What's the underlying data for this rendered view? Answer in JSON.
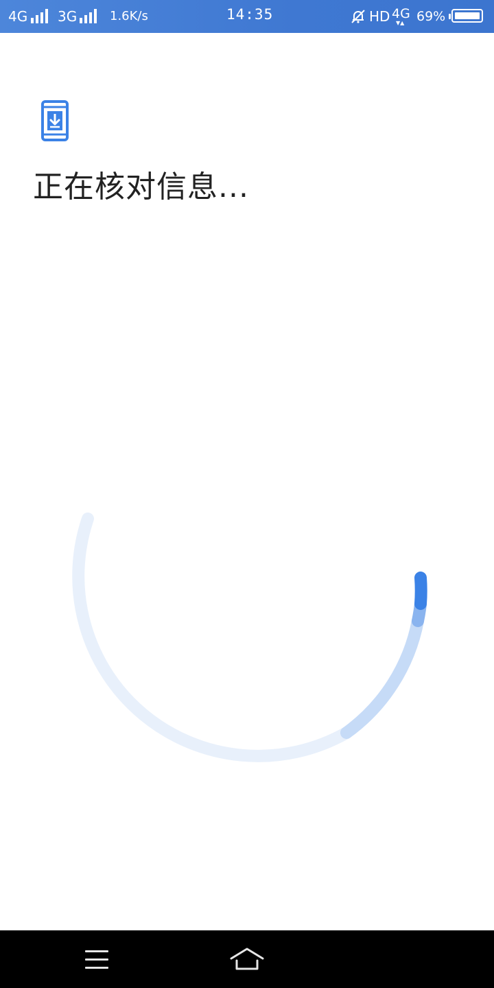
{
  "status_bar": {
    "network_1": "4G",
    "network_2": "3G",
    "speed": "1.6K/s",
    "time": "14:35",
    "hd": "HD",
    "network_3": "4G",
    "battery": "69%"
  },
  "main": {
    "title": "正在核对信息..."
  },
  "progress": {
    "state": "indeterminate",
    "track_color": "#e8f0fb",
    "mid_color": "#c6dbf7",
    "accent_color": "#3b82e6"
  },
  "nav_bar": {
    "menu_icon": "hamburger-icon",
    "home_icon": "home-icon"
  }
}
